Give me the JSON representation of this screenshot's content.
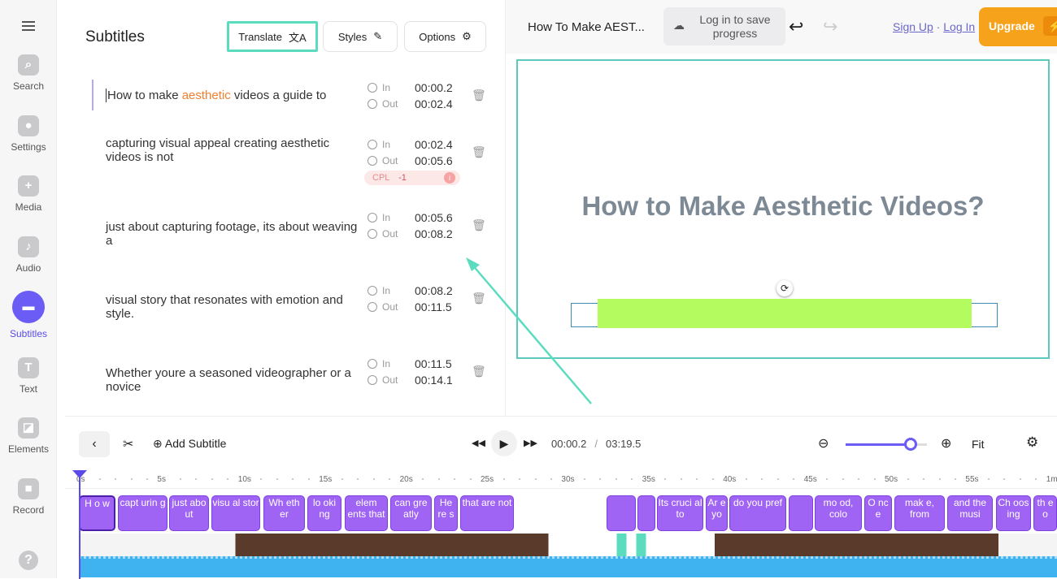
{
  "sidebar": {
    "items": [
      {
        "label": "Search",
        "icon": "search-icon",
        "glyph": "⌕"
      },
      {
        "label": "Settings",
        "icon": "gear-icon",
        "glyph": "●"
      },
      {
        "label": "Media",
        "icon": "plus-icon",
        "glyph": "+"
      },
      {
        "label": "Audio",
        "icon": "music-note-icon",
        "glyph": "♪"
      },
      {
        "label": "Subtitles",
        "icon": "subtitles-icon",
        "glyph": "▬",
        "active": true
      },
      {
        "label": "Text",
        "icon": "text-icon",
        "glyph": "T"
      },
      {
        "label": "Elements",
        "icon": "elements-icon",
        "glyph": "◪"
      },
      {
        "label": "Record",
        "icon": "record-icon",
        "glyph": "■"
      }
    ],
    "help": "?"
  },
  "panel": {
    "title": "Subtitles",
    "translate": "Translate",
    "styles": "Styles",
    "options": "Options",
    "in_label": "In",
    "out_label": "Out",
    "rows": [
      {
        "pre": "How to make ",
        "highlight": "aesthetic",
        "post": " videos a guide to",
        "in": "00:00.2",
        "out": "00:02.4"
      },
      {
        "text": "capturing visual appeal creating aesthetic videos is not",
        "in": "00:02.4",
        "out": "00:05.6",
        "cpl_label": "CPL",
        "cpl_value": "-1"
      },
      {
        "text": "just about capturing footage, its about weaving a",
        "in": "00:05.6",
        "out": "00:08.2"
      },
      {
        "text": "visual story that resonates with emotion and style.",
        "in": "00:08.2",
        "out": "00:11.5"
      },
      {
        "text": "Whether youre a seasoned videographer or a novice",
        "in": "00:11.5",
        "out": "00:14.1"
      }
    ]
  },
  "header": {
    "project_title": "How To Make AEST...",
    "save_prompt": "Log in to save progress",
    "sign_up": "Sign Up",
    "separator": "·",
    "log_in": "Log In",
    "upgrade": "Upgrade"
  },
  "preview": {
    "title_text": "How to Make Aesthetic Videos?"
  },
  "timeline": {
    "add_subtitle": "Add Subtitle",
    "current_time": "00:00.2",
    "divider": "/",
    "total_time": "03:19.5",
    "fit": "Fit",
    "zoom_level": 0.8,
    "ticks": [
      "0s",
      "5s",
      "10s",
      "15s",
      "20s",
      "25s",
      "30s",
      "35s",
      "40s",
      "45s",
      "50s",
      "55s",
      "1m"
    ],
    "clips": [
      "H o w",
      "capt urin g",
      "just abo ut",
      "visu al stor",
      "Wh eth er",
      "lo oki ng",
      "elem ents that",
      "can gre atly",
      "He re s",
      "that are not",
      "",
      "",
      "Its cruci al to",
      "Ar e yo",
      "do you pref",
      "",
      "mo od, colo",
      "O nc e",
      "mak e, from",
      "and the musi",
      "Ch oos ing",
      "th e o"
    ]
  },
  "colors": {
    "accent": "#6b5cf5",
    "clip": "#a064f5",
    "highlight": "#f07f2e",
    "upgrade": "#f7a21b",
    "callout": "#5cdcbf",
    "subtitle_box": "#b3fb5e"
  }
}
